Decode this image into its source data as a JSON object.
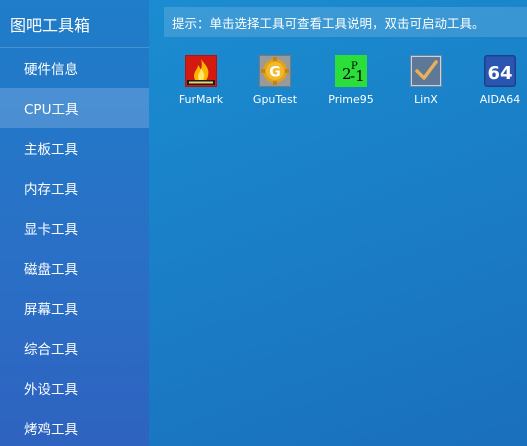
{
  "app": {
    "title": "图吧工具箱"
  },
  "sidebar": {
    "items": [
      {
        "label": "硬件信息"
      },
      {
        "label": "CPU工具",
        "active": true
      },
      {
        "label": "主板工具"
      },
      {
        "label": "内存工具"
      },
      {
        "label": "显卡工具"
      },
      {
        "label": "磁盘工具"
      },
      {
        "label": "屏幕工具"
      },
      {
        "label": "综合工具"
      },
      {
        "label": "外设工具"
      },
      {
        "label": "烤鸡工具"
      }
    ]
  },
  "hint": {
    "text": "提示：单击选择工具可查看工具说明，双击可启动工具。"
  },
  "tools": [
    {
      "name": "FurMark",
      "icon": "furmark-icon"
    },
    {
      "name": "GpuTest",
      "icon": "gputest-icon"
    },
    {
      "name": "Prime95",
      "icon": "prime95-icon"
    },
    {
      "name": "LinX",
      "icon": "linx-icon"
    },
    {
      "name": "AIDA64",
      "icon": "aida64-icon"
    }
  ],
  "colors": {
    "background": "#1a7fc9",
    "sidebar": "#2a6fc6",
    "active_item": "#4a8ed3",
    "text": "#ffffff"
  }
}
